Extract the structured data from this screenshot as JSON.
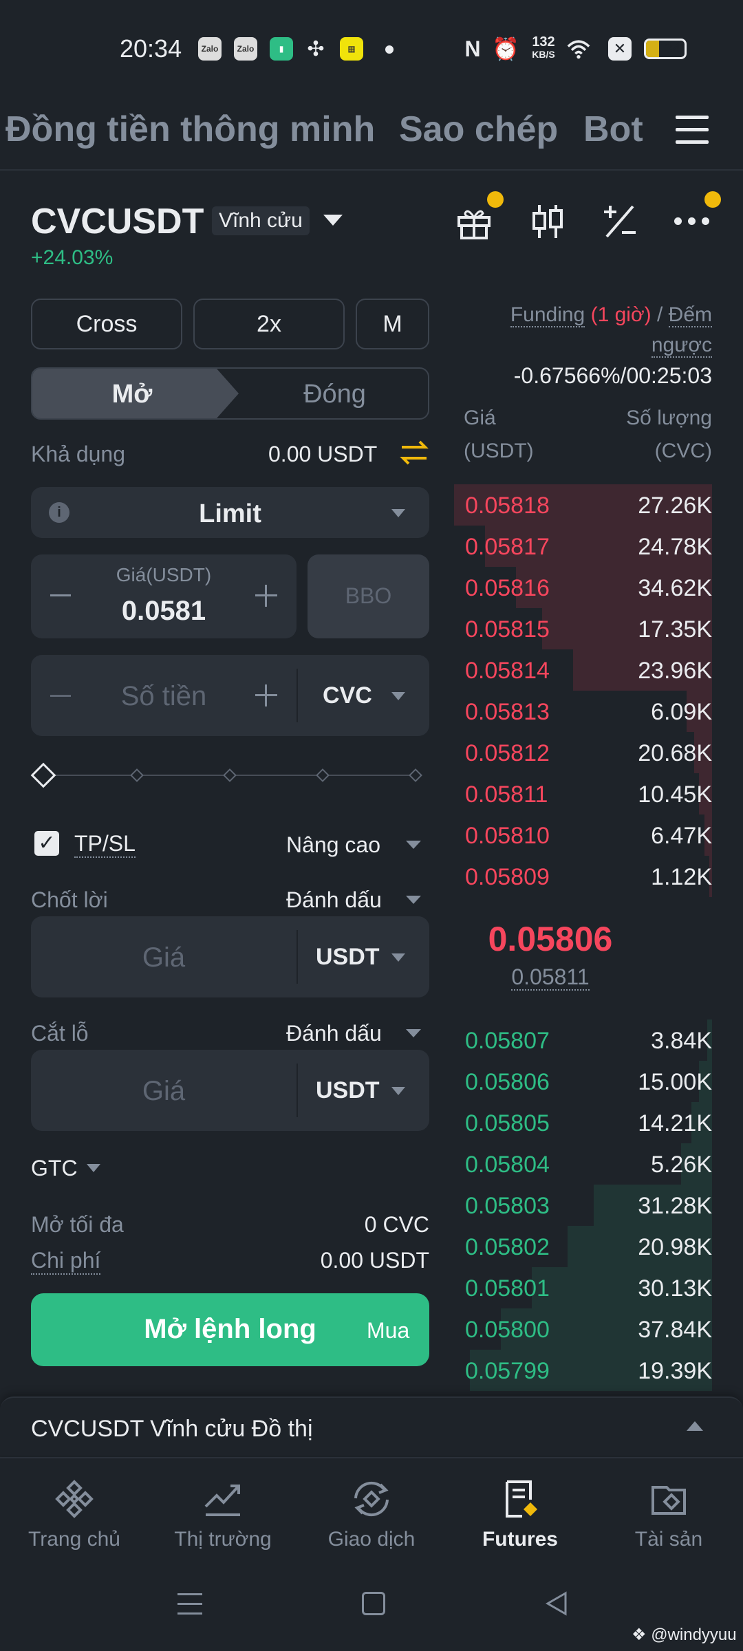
{
  "status": {
    "time": "20:34",
    "icons": [
      "zalo-icon",
      "zalo-icon",
      "battery-saver-icon",
      "fan-icon",
      "app-icon",
      "dot-icon",
      "nfc-icon",
      "alarm-icon",
      "wifi-icon",
      "sim-icon",
      "battery-icon"
    ],
    "zalo": "Zalo",
    "net_speed": "132",
    "net_unit": "KB/S",
    "battery": "34"
  },
  "topnav": {
    "tabs": [
      "Đồng tiền thông minh",
      "Sao chép",
      "Bot"
    ]
  },
  "header": {
    "symbol": "CVCUSDT",
    "contract_type": "Vĩnh cửu",
    "change": "+24.03%"
  },
  "order": {
    "margin_mode": "Cross",
    "leverage": "2x",
    "mode_m": "M",
    "open_label": "Mở",
    "close_label": "Đóng",
    "available_label": "Khả dụng",
    "available_value": "0.00 USDT",
    "order_type": "Limit",
    "price_label": "Giá(USDT)",
    "price_value": "0.0581",
    "bbo": "BBO",
    "amount_placeholder": "Số tiền",
    "amount_unit": "CVC",
    "tpsl_label": "TP/SL",
    "advanced_label": "Nâng cao",
    "tp_label": "Chốt lời",
    "tp_trigger": "Đánh dấu",
    "tp_price_placeholder": "Giá",
    "tp_unit": "USDT",
    "sl_label": "Cắt lỗ",
    "sl_trigger": "Đánh dấu",
    "sl_price_placeholder": "Giá",
    "sl_unit": "USDT",
    "tif": "GTC",
    "max_open_label": "Mở tối đa",
    "max_open_value": "0 CVC",
    "cost_label": "Chi phí",
    "cost_value": "0.00 USDT",
    "submit_label": "Mở lệnh long",
    "submit_side": "Mua",
    "tpsl_checked": true
  },
  "funding": {
    "label": "Funding",
    "interval": "(1 giờ)",
    "sep": "/",
    "countdown_label": "Đếm",
    "countdown_label2": "ngược",
    "value": "-0.67566%/00:25:03"
  },
  "orderbook": {
    "price_header": "Giá",
    "price_unit": "(USDT)",
    "qty_header": "Số lượng",
    "qty_unit": "(CVC)",
    "asks": [
      {
        "price": "0.05818",
        "qty": "27.26K",
        "depth": 1.0
      },
      {
        "price": "0.05817",
        "qty": "24.78K",
        "depth": 0.88
      },
      {
        "price": "0.05816",
        "qty": "34.62K",
        "depth": 0.76
      },
      {
        "price": "0.05815",
        "qty": "17.35K",
        "depth": 0.66
      },
      {
        "price": "0.05814",
        "qty": "23.96K",
        "depth": 0.54
      },
      {
        "price": "0.05813",
        "qty": "6.09K",
        "depth": 0.1
      },
      {
        "price": "0.05812",
        "qty": "20.68K",
        "depth": 0.07
      },
      {
        "price": "0.05811",
        "qty": "10.45K",
        "depth": 0.05
      },
      {
        "price": "0.05810",
        "qty": "6.47K",
        "depth": 0.03
      },
      {
        "price": "0.05809",
        "qty": "1.12K",
        "depth": 0.01
      }
    ],
    "last_price": "0.05806",
    "mark_price": "0.05811",
    "bids": [
      {
        "price": "0.05807",
        "qty": "3.84K",
        "depth": 0.02
      },
      {
        "price": "0.05806",
        "qty": "15.00K",
        "depth": 0.05
      },
      {
        "price": "0.05805",
        "qty": "14.21K",
        "depth": 0.08
      },
      {
        "price": "0.05804",
        "qty": "5.26K",
        "depth": 0.12
      },
      {
        "price": "0.05803",
        "qty": "31.28K",
        "depth": 0.46
      },
      {
        "price": "0.05802",
        "qty": "20.98K",
        "depth": 0.56
      },
      {
        "price": "0.05801",
        "qty": "30.13K",
        "depth": 0.7
      },
      {
        "price": "0.05800",
        "qty": "37.84K",
        "depth": 0.82
      },
      {
        "price": "0.05799",
        "qty": "19.39K",
        "depth": 0.94
      }
    ]
  },
  "chart_panel": {
    "title": "CVCUSDT Vĩnh cửu Đồ thị"
  },
  "bottomnav": [
    {
      "label": "Trang chủ",
      "icon": "binance-logo-icon"
    },
    {
      "label": "Thị trường",
      "icon": "chart-line-icon"
    },
    {
      "label": "Giao dịch",
      "icon": "trade-swap-icon"
    },
    {
      "label": "Futures",
      "icon": "futures-icon",
      "active": true
    },
    {
      "label": "Tài sản",
      "icon": "wallet-icon"
    }
  ],
  "watermark": "@windyyuu",
  "colors": {
    "bg": "#1e2329",
    "panel": "#2b3139",
    "green": "#2ebd85",
    "red": "#f6465d",
    "yellow": "#f0b90b",
    "muted": "#848e9c"
  }
}
